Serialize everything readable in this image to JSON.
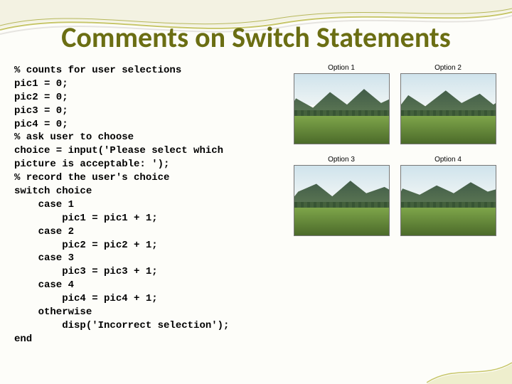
{
  "title": "Comments on Switch Statements",
  "code_lines": [
    "% counts for user selections",
    "pic1 = 0;",
    "pic2 = 0;",
    "pic3 = 0;",
    "pic4 = 0;",
    "% ask user to choose",
    "choice = input('Please select which",
    "picture is acceptable: ');",
    "% record the user's choice",
    "switch choice",
    "    case 1",
    "        pic1 = pic1 + 1;",
    "    case 2",
    "        pic2 = pic2 + 1;",
    "    case 3",
    "        pic3 = pic3 + 1;",
    "    case 4",
    "        pic4 = pic4 + 1;",
    "    otherwise",
    "        disp('Incorrect selection');",
    "end"
  ],
  "options": [
    {
      "label": "Option 1"
    },
    {
      "label": "Option 2"
    },
    {
      "label": "Option 3"
    },
    {
      "label": "Option 4"
    }
  ]
}
